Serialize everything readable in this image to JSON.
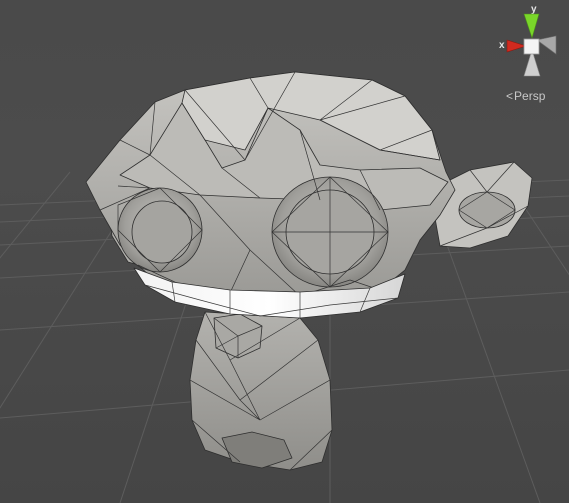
{
  "scene_view": {
    "background_color": "#474747",
    "grid_color": "#5e5e5e",
    "model": {
      "name": "Suzanne",
      "render_mode": "shaded-wireframe",
      "surface_color": "#b4b3af",
      "wire_color": "#2c2c2c"
    }
  },
  "gizmo": {
    "x_axis_label": "x",
    "y_axis_label": "y",
    "x_color": "#d12a1f",
    "y_color": "#7ad62a",
    "z_color": "#e2e2e2",
    "center_color": "#f4f4f4"
  },
  "projection": {
    "chevron": "<",
    "label": "Persp"
  }
}
